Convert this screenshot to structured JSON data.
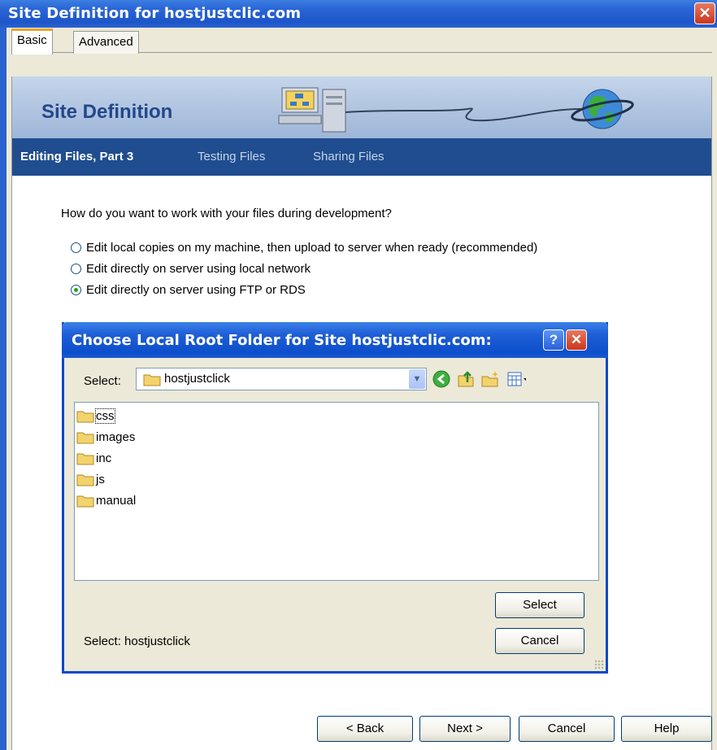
{
  "window": {
    "title": "Site Definition for hostjustclic.com"
  },
  "tabs": [
    {
      "label": "Basic",
      "active": true
    },
    {
      "label": "Advanced",
      "active": false
    }
  ],
  "banner": {
    "title": "Site Definition"
  },
  "steps": [
    {
      "label": "Editing Files, Part 3",
      "current": true
    },
    {
      "label": "Testing Files",
      "current": false
    },
    {
      "label": "Sharing Files",
      "current": false
    }
  ],
  "question": "How do you want to work with your files during development?",
  "options": [
    {
      "label": "Edit local copies on my machine, then upload to server when ready (recommended)",
      "checked": false
    },
    {
      "label": "Edit directly on server using local network",
      "checked": false
    },
    {
      "label": "Edit directly on server using FTP or RDS",
      "checked": true
    }
  ],
  "dialog": {
    "title": "Choose Local Root Folder for Site hostjustclic.com:",
    "help_label": "?",
    "close_label": "✕",
    "select_label": "Select:",
    "current_folder": "hostjustclick",
    "folders": [
      "css",
      "images",
      "inc",
      "js",
      "manual"
    ],
    "select_button": "Select",
    "cancel_button": "Cancel",
    "status": "Select: hostjustclick"
  },
  "footer": {
    "back": "< Back",
    "next": "Next >",
    "cancel": "Cancel",
    "help": "Help"
  },
  "colors": {
    "accent": "#1f4d8f",
    "titlebar": "#2a63cf",
    "dialog_border": "#0a49c8"
  }
}
